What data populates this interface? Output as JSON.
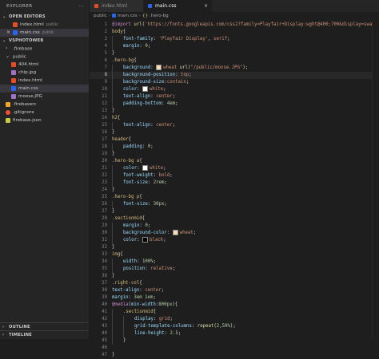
{
  "explorer": {
    "title": "EXPLORER",
    "more_icon": "ellipsis-icon",
    "open_editors": {
      "label": "OPEN EDITORS",
      "items": [
        {
          "name": "index.html",
          "folder": "public",
          "type": "html"
        },
        {
          "name": "main.css",
          "folder": "public",
          "type": "css"
        }
      ]
    },
    "project": {
      "label": "VSPHOTOWEB",
      "items": [
        {
          "name": ".firebase",
          "type": "folder",
          "indent": 1
        },
        {
          "name": "public",
          "type": "folder-open",
          "indent": 1
        },
        {
          "name": "404.html",
          "type": "html",
          "indent": 2
        },
        {
          "name": "chip.jpg",
          "type": "img",
          "indent": 2
        },
        {
          "name": "index.html",
          "type": "html",
          "indent": 2
        },
        {
          "name": "main.css",
          "type": "css",
          "indent": 2
        },
        {
          "name": "moose.JPG",
          "type": "img",
          "indent": 2
        },
        {
          "name": ".firebaserc",
          "type": "fb",
          "indent": 1
        },
        {
          "name": ".gitignore",
          "type": "git",
          "indent": 1
        },
        {
          "name": "firebase.json",
          "type": "json",
          "indent": 1
        }
      ]
    },
    "outline_label": "OUTLINE",
    "timeline_label": "TIMELINE"
  },
  "tabs": [
    {
      "label": "index.html",
      "type": "html",
      "active": false
    },
    {
      "label": "main.css",
      "type": "css",
      "active": true,
      "close": "×"
    }
  ],
  "breadcrumb": {
    "folder": "public",
    "file": "main.css",
    "symbol": ".hero-bg",
    "sep": "›"
  },
  "editor": {
    "current_line": 8,
    "colors": {
      "white": "#ffffff",
      "wheat": "#f5deb3",
      "black": "#000000"
    },
    "lines": [
      {
        "n": "1",
        "indent": 0,
        "t": [
          [
            "kw",
            "@import "
          ],
          [
            "fn",
            "url("
          ],
          [
            "val",
            "'https://fonts.googleapis.com/css2?family=Playfair+Display:wght@400;700&display=swap'"
          ],
          [
            "fn",
            ")"
          ],
          [
            "pun",
            ";"
          ]
        ]
      },
      {
        "n": "2",
        "indent": 0,
        "t": [
          [
            "sel-t",
            "body"
          ],
          [
            "pun",
            "{"
          ]
        ]
      },
      {
        "n": "3",
        "indent": 1,
        "t": [
          [
            "prop",
            "font-family"
          ],
          [
            "pun",
            ": "
          ],
          [
            "val",
            "'Playfair Display'"
          ],
          [
            "pun",
            ", "
          ],
          [
            "val",
            "serif"
          ],
          [
            "pun",
            ";"
          ]
        ]
      },
      {
        "n": "4",
        "indent": 1,
        "t": [
          [
            "prop",
            "margin"
          ],
          [
            "pun",
            ": "
          ],
          [
            "num",
            "0"
          ],
          [
            "pun",
            ";"
          ]
        ]
      },
      {
        "n": "5",
        "indent": 0,
        "t": [
          [
            "pun",
            "}"
          ]
        ]
      },
      {
        "n": "6",
        "indent": 0,
        "t": [
          [
            "sel-t",
            ".hero-bg"
          ],
          [
            "pun",
            "{"
          ]
        ]
      },
      {
        "n": "7",
        "indent": 1,
        "t": [
          [
            "prop",
            "background"
          ],
          [
            "pun",
            ": "
          ],
          [
            "sw",
            "wheat"
          ],
          [
            "val",
            "wheat "
          ],
          [
            "fn",
            "url("
          ],
          [
            "val",
            "\"/public/moose.JPG\""
          ],
          [
            "fn",
            ")"
          ],
          [
            "pun",
            ";"
          ]
        ]
      },
      {
        "n": "8",
        "indent": 1,
        "t": [
          [
            "prop",
            "background-position"
          ],
          [
            "pun",
            ": "
          ],
          [
            "val",
            "top"
          ],
          [
            "pun",
            ";"
          ]
        ]
      },
      {
        "n": "9",
        "indent": 1,
        "t": [
          [
            "prop",
            "background-size"
          ],
          [
            "pun",
            ":"
          ],
          [
            "val",
            "contain"
          ],
          [
            "pun",
            ";"
          ]
        ]
      },
      {
        "n": "10",
        "indent": 1,
        "t": [
          [
            "prop",
            "color"
          ],
          [
            "pun",
            ": "
          ],
          [
            "sw",
            "white"
          ],
          [
            "val",
            "white"
          ],
          [
            "pun",
            ";"
          ]
        ]
      },
      {
        "n": "11",
        "indent": 1,
        "t": [
          [
            "prop",
            "text-align"
          ],
          [
            "pun",
            ": "
          ],
          [
            "val",
            "center"
          ],
          [
            "pun",
            ";"
          ]
        ]
      },
      {
        "n": "12",
        "indent": 1,
        "t": [
          [
            "prop",
            "padding-bottom"
          ],
          [
            "pun",
            ": "
          ],
          [
            "num",
            "4em"
          ],
          [
            "pun",
            ";"
          ]
        ]
      },
      {
        "n": "13",
        "indent": 0,
        "t": [
          [
            "pun",
            "}"
          ]
        ]
      },
      {
        "n": "14",
        "indent": 0,
        "t": [
          [
            "sel-t",
            "h2"
          ],
          [
            "pun",
            "{"
          ]
        ]
      },
      {
        "n": "15",
        "indent": 1,
        "t": [
          [
            "prop",
            "text-align"
          ],
          [
            "pun",
            ": "
          ],
          [
            "val",
            "center"
          ],
          [
            "pun",
            ";"
          ]
        ]
      },
      {
        "n": "16",
        "indent": 0,
        "t": [
          [
            "pun",
            "}"
          ]
        ]
      },
      {
        "n": "17",
        "indent": 0,
        "t": [
          [
            "sel-t",
            "header"
          ],
          [
            "pun",
            "{"
          ]
        ]
      },
      {
        "n": "18",
        "indent": 1,
        "t": [
          [
            "prop",
            "padding"
          ],
          [
            "pun",
            ": "
          ],
          [
            "num",
            "0"
          ],
          [
            "pun",
            ";"
          ]
        ]
      },
      {
        "n": "19",
        "indent": 0,
        "t": [
          [
            "pun",
            "}"
          ]
        ]
      },
      {
        "n": "20",
        "indent": 0,
        "t": [
          [
            "sel-t",
            ".hero-bg a"
          ],
          [
            "pun",
            "{"
          ]
        ]
      },
      {
        "n": "21",
        "indent": 1,
        "t": [
          [
            "prop",
            "color"
          ],
          [
            "pun",
            ": "
          ],
          [
            "sw",
            "white"
          ],
          [
            "val",
            "white"
          ],
          [
            "pun",
            ";"
          ]
        ]
      },
      {
        "n": "22",
        "indent": 1,
        "t": [
          [
            "prop",
            "font-weight"
          ],
          [
            "pun",
            ": "
          ],
          [
            "val",
            "bold"
          ],
          [
            "pun",
            ";"
          ]
        ]
      },
      {
        "n": "23",
        "indent": 1,
        "t": [
          [
            "prop",
            "font-size"
          ],
          [
            "pun",
            ": "
          ],
          [
            "num",
            "2rem"
          ],
          [
            "pun",
            ";"
          ]
        ]
      },
      {
        "n": "24",
        "indent": 0,
        "t": [
          [
            "pun",
            "}"
          ]
        ]
      },
      {
        "n": "25",
        "indent": 0,
        "t": [
          [
            "sel-t",
            ".hero-bg p"
          ],
          [
            "pun",
            "{"
          ]
        ]
      },
      {
        "n": "26",
        "indent": 1,
        "t": [
          [
            "prop",
            "font-size"
          ],
          [
            "pun",
            ": "
          ],
          [
            "num",
            "30px"
          ],
          [
            "pun",
            ";"
          ]
        ]
      },
      {
        "n": "27",
        "indent": 0,
        "t": [
          [
            "pun",
            "}"
          ]
        ]
      },
      {
        "n": "28",
        "indent": 0,
        "t": [
          [
            "sel-t",
            ".sectionmid"
          ],
          [
            "pun",
            "{"
          ]
        ]
      },
      {
        "n": "29",
        "indent": 1,
        "t": [
          [
            "prop",
            "margin"
          ],
          [
            "pun",
            ": "
          ],
          [
            "num",
            "0"
          ],
          [
            "pun",
            ";"
          ]
        ]
      },
      {
        "n": "30",
        "indent": 1,
        "t": [
          [
            "prop",
            "background-color"
          ],
          [
            "pun",
            ": "
          ],
          [
            "sw",
            "wheat"
          ],
          [
            "val",
            "wheat"
          ],
          [
            "pun",
            ";"
          ]
        ]
      },
      {
        "n": "31",
        "indent": 1,
        "t": [
          [
            "prop",
            "color"
          ],
          [
            "pun",
            ": "
          ],
          [
            "sw",
            "black"
          ],
          [
            "val",
            "black"
          ],
          [
            "pun",
            ";"
          ]
        ]
      },
      {
        "n": "32",
        "indent": 0,
        "t": [
          [
            "pun",
            "}"
          ]
        ]
      },
      {
        "n": "33",
        "indent": 0,
        "t": [
          [
            "sel-t",
            "img"
          ],
          [
            "pun",
            "{"
          ]
        ]
      },
      {
        "n": "34",
        "indent": 1,
        "t": [
          [
            "prop",
            "width"
          ],
          [
            "pun",
            ": "
          ],
          [
            "num",
            "100%"
          ],
          [
            "pun",
            ";"
          ]
        ]
      },
      {
        "n": "35",
        "indent": 1,
        "t": [
          [
            "prop",
            "position"
          ],
          [
            "pun",
            ": "
          ],
          [
            "val",
            "relative"
          ],
          [
            "pun",
            ";"
          ]
        ]
      },
      {
        "n": "36",
        "indent": 0,
        "t": [
          [
            "pun",
            "}"
          ]
        ]
      },
      {
        "n": "37",
        "indent": 0,
        "t": [
          [
            "sel-t",
            ".right-col"
          ],
          [
            "pun",
            "{"
          ]
        ]
      },
      {
        "n": "38",
        "indent": 0,
        "t": [
          [
            "prop",
            "text-align"
          ],
          [
            "pun",
            ": "
          ],
          [
            "val",
            "center"
          ],
          [
            "pun",
            ";"
          ]
        ]
      },
      {
        "n": "39",
        "indent": 0,
        "t": [
          [
            "prop",
            "margin"
          ],
          [
            "pun",
            ": "
          ],
          [
            "num",
            "3em 1em"
          ],
          [
            "pun",
            ";"
          ]
        ]
      },
      {
        "n": "40",
        "indent": 0,
        "t": [
          [
            "kw",
            "@media"
          ],
          [
            "pun",
            "("
          ],
          [
            "prop",
            "min-width"
          ],
          [
            "pun",
            ":"
          ],
          [
            "num",
            "800px"
          ],
          [
            "pun",
            "){"
          ]
        ]
      },
      {
        "n": "41",
        "indent": 1,
        "t": [
          [
            "sel-t",
            ".sectionmid"
          ],
          [
            "pun",
            "{"
          ]
        ]
      },
      {
        "n": "42",
        "indent": 2,
        "t": [
          [
            "prop",
            "display"
          ],
          [
            "pun",
            ": "
          ],
          [
            "val",
            "grid"
          ],
          [
            "pun",
            ";"
          ]
        ]
      },
      {
        "n": "43",
        "indent": 2,
        "t": [
          [
            "prop",
            "grid-template-columns"
          ],
          [
            "pun",
            ": "
          ],
          [
            "fn",
            "repeat("
          ],
          [
            "num",
            "2"
          ],
          [
            "pun",
            ","
          ],
          [
            "num",
            "50%"
          ],
          [
            "fn",
            ")"
          ],
          [
            "pun",
            ";"
          ]
        ]
      },
      {
        "n": "44",
        "indent": 2,
        "t": [
          [
            "prop",
            "line-height"
          ],
          [
            "pun",
            ": "
          ],
          [
            "num",
            "2.5"
          ],
          [
            "pun",
            ";"
          ]
        ]
      },
      {
        "n": "45",
        "indent": 1,
        "t": [
          [
            "pun",
            "}"
          ]
        ]
      },
      {
        "n": "46",
        "indent": 0,
        "t": []
      },
      {
        "n": "47",
        "indent": 0,
        "t": [
          [
            "pun",
            "}"
          ]
        ]
      }
    ]
  }
}
